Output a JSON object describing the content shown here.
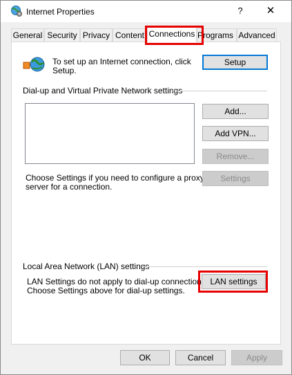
{
  "window": {
    "title": "Internet Properties",
    "help_label": "?",
    "close_label": "✕",
    "icon": "globe-gear-icon"
  },
  "tabs": [
    {
      "label": "General"
    },
    {
      "label": "Security"
    },
    {
      "label": "Privacy"
    },
    {
      "label": "Content"
    },
    {
      "label": "Connections"
    },
    {
      "label": "Programs"
    },
    {
      "label": "Advanced"
    }
  ],
  "active_tab": "Connections",
  "setup": {
    "icon": "network-connection-icon",
    "text_line1": "To set up an Internet connection, click",
    "text_line2": "Setup.",
    "button": "Setup"
  },
  "dialup": {
    "group_label": "Dial-up and Virtual Private Network settings",
    "add_button": "Add...",
    "add_vpn_button": "Add VPN...",
    "remove_button": "Remove...",
    "settings_button": "Settings",
    "proxy_text_line1": "Choose Settings if you need to configure a proxy",
    "proxy_text_line2": "server for a connection."
  },
  "lan": {
    "group_label": "Local Area Network (LAN) settings",
    "text_line1": "LAN Settings do not apply to dial-up connections.",
    "text_line2": "Choose Settings above for dial-up settings.",
    "button": "LAN settings"
  },
  "footer": {
    "ok": "OK",
    "cancel": "Cancel",
    "apply": "Apply"
  },
  "colors": {
    "highlight": "#e60000",
    "default_button_border": "#0078d7"
  }
}
